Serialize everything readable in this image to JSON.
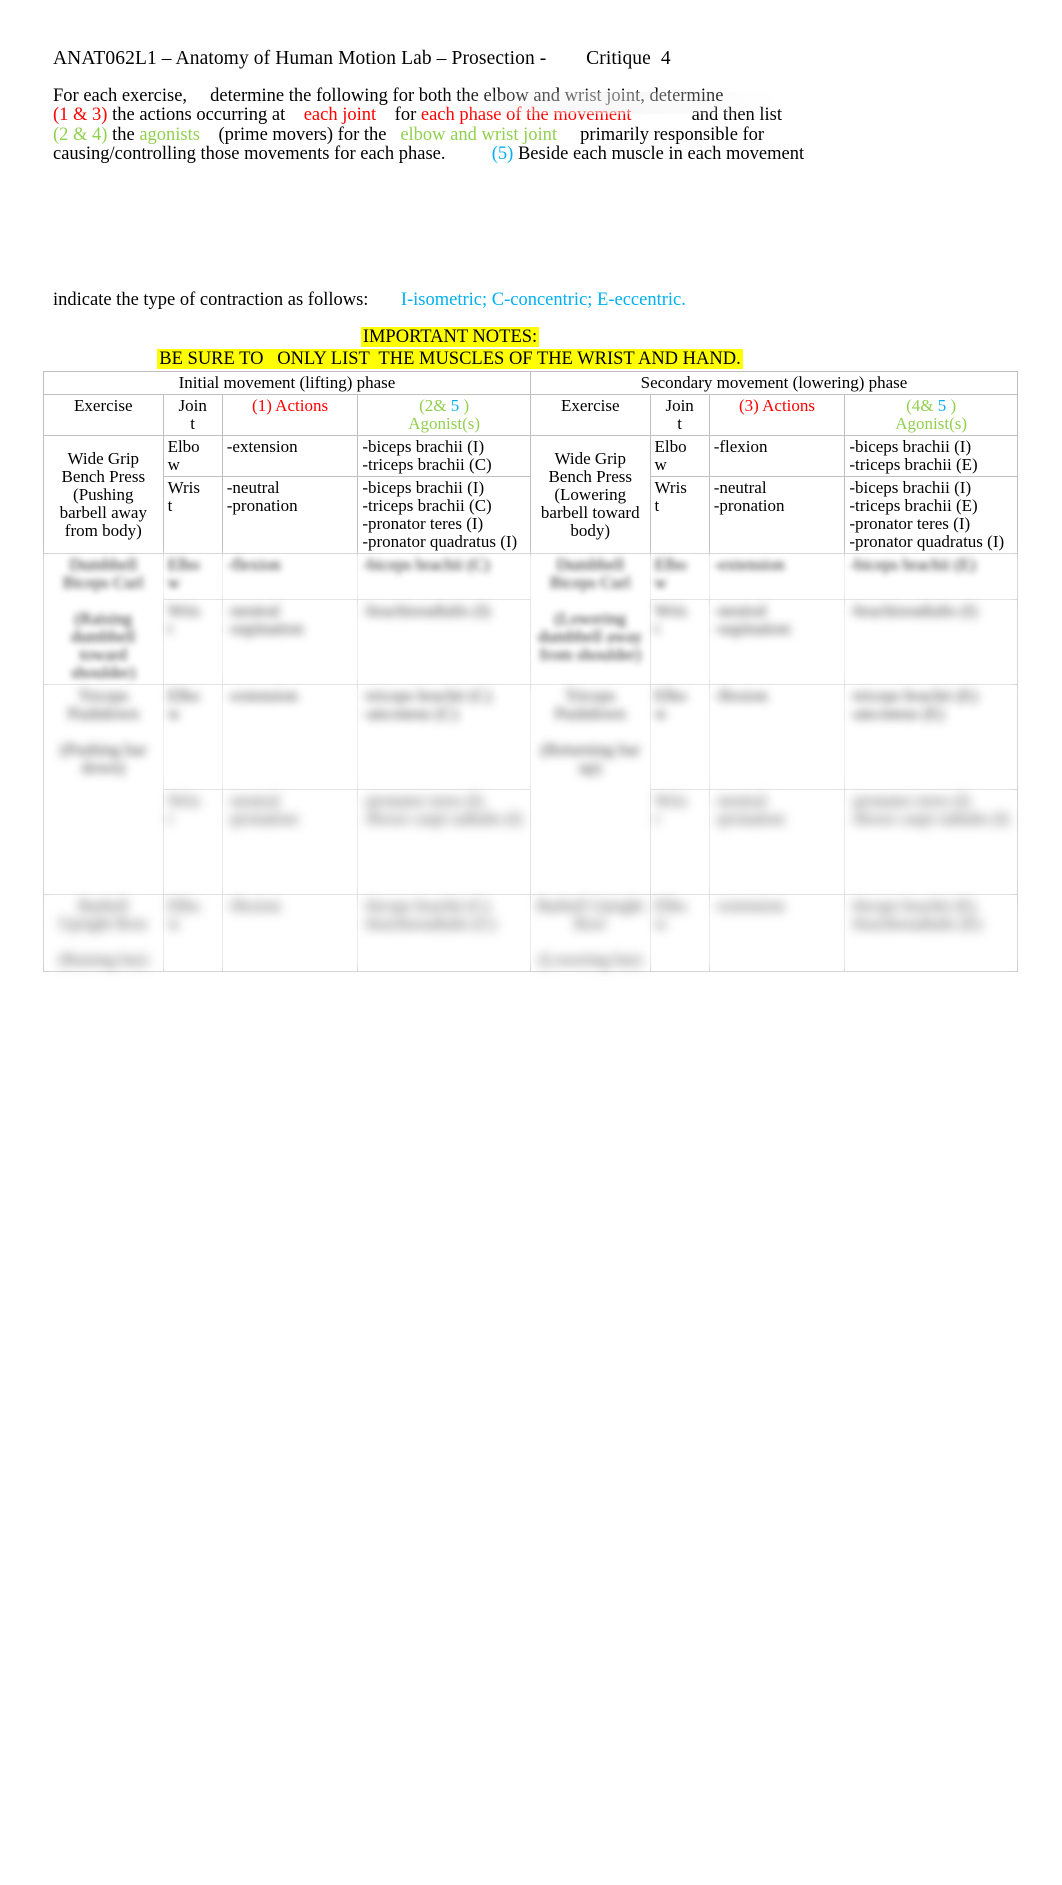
{
  "document": {
    "title": "ANAT062L1 – Anatomy of Human Motion Lab – Prosection -        Critique  4",
    "instructions": {
      "line1": "For each exercise,     determine the following for both the elbow and wrist joint, determine",
      "line2_a": "(1 & 3)",
      "line2_b": " the actions occurring at ",
      "line2_c": "   each joint",
      "line2_d": "    for ",
      "line2_e": "each phase of the movement",
      "line2_f": "             and then list",
      "line3_a": "(2 & 4)",
      "line3_b": " the ",
      "line3_c": "agonists",
      "line3_d": "    (prime movers) for the   ",
      "line3_e": "elbow and wrist joint",
      "line3_f": "     primarily responsible for",
      "line4_a": "causing/controlling those movements for each phase.          ",
      "line4_b": "(5)",
      "line4_c": " Beside each muscle in each movement"
    },
    "contraction": {
      "label": "indicate the type of contraction as follows:       ",
      "legend": "I-isometric; C-concentric; E-eccentric."
    },
    "notes": {
      "heading": "IMPORTANT NOTES:",
      "body": "BE SURE TO   ONLY LIST  THE MUSCLES OF THE WRIST AND HAND."
    },
    "colors": {
      "red": "#ff0000",
      "green": "#92d050",
      "cyan": "#00b0f0",
      "highlight": "#ffff00",
      "shade": "#e8e8e8",
      "border": "#bfbfbf"
    }
  },
  "table": {
    "phase_headers": {
      "initial": "Initial movement (lifting) phase",
      "secondary": "Secondary movement (lowering) phase"
    },
    "columns": {
      "exercise": "Exercise",
      "joint": "Join\nt",
      "actions_initial_num": "(1)",
      "actions_initial": " Actions",
      "agonists_initial_num": "(2& ",
      "agonists_initial_five": "5",
      "agonists_initial_close": " )",
      "agonists_initial_label": "Agonist(s)",
      "actions_secondary_num": "(3)",
      "actions_secondary": " Actions",
      "agonists_secondary_num": "(4& ",
      "agonists_secondary_five": "5",
      "agonists_secondary_close": " )",
      "agonists_secondary_label": "Agonist(s)"
    },
    "rows": [
      {
        "exercise_initial": "Wide Grip Bench Press\n\n(Pushing barbell away from body)",
        "exercise_secondary": "Wide Grip Bench Press (Lowering barbell toward body)",
        "joints": [
          {
            "joint": "Elbo\nw",
            "action_initial": "-extension",
            "agonists_initial": "-biceps brachii (I)\n-triceps brachii (C)",
            "action_secondary": "-flexion",
            "agonists_secondary": "-biceps brachii (I)\n-triceps brachii (E)"
          },
          {
            "joint": "Wris\nt",
            "action_initial": "-neutral\n-pronation",
            "agonists_initial": "-biceps brachii (I)\n-triceps brachii (C)\n-pronator teres (I)\n-pronator quadratus (I)",
            "action_secondary": "-neutral\n-pronation",
            "agonists_secondary": "-biceps brachii (I)\n-triceps brachii (E)\n-pronator teres (I)\n-pronator quadratus (I)"
          }
        ]
      },
      {
        "exercise_initial": "Dumbbell\nBiceps Curl\n\n(Raising dumbbell toward shoulder)",
        "exercise_secondary": "Dumbbell Biceps Curl\n\n(Lowering dumbbell away from shoulder)",
        "joints": [
          {
            "joint": "Elbo\nw",
            "action_initial": "-flexion",
            "agonists_initial": "-biceps brachii (C)",
            "action_secondary": "-extension",
            "agonists_secondary": "-biceps brachii (E)"
          },
          {
            "joint": "Wris\nt",
            "action_initial": "-neutral\n-supination",
            "agonists_initial": "-brachioradialis (I)",
            "action_secondary": "-neutral\n-supination",
            "agonists_secondary": "-brachioradialis (I)"
          }
        ]
      },
      {
        "exercise_initial": "Triceps\nPushdown\n\n(Pushing bar down)",
        "exercise_secondary": "Triceps Pushdown\n\n(Returning bar up)",
        "joints": [
          {
            "joint": "Elbo\nw",
            "action_initial": "-extension",
            "agonists_initial": "-triceps brachii (C)\n-anconeus (C)",
            "action_secondary": "-flexion",
            "agonists_secondary": "-triceps brachii (E)\n-anconeus (E)"
          },
          {
            "joint": "Wris\nt",
            "action_initial": "-neutral\n-pronation",
            "agonists_initial": "-pronator teres (I)\n-flexor carpi radialis (I)",
            "action_secondary": "-neutral\n-pronation",
            "agonists_secondary": "-pronator teres (I)\n-flexor carpi radialis (I)"
          }
        ]
      },
      {
        "exercise_initial": "Barbell\nUpright Row\n\n(Raising bar)",
        "exercise_secondary": "Barbell Upright Row\n\n(Lowering bar)",
        "joints": [
          {
            "joint": "Elbo\nw",
            "action_initial": "-flexion",
            "agonists_initial": "-biceps brachii (C)\n-brachioradialis (C)",
            "action_secondary": "-extension",
            "agonists_secondary": "-biceps brachii (E)\n-brachioradialis (E)"
          }
        ]
      }
    ]
  }
}
